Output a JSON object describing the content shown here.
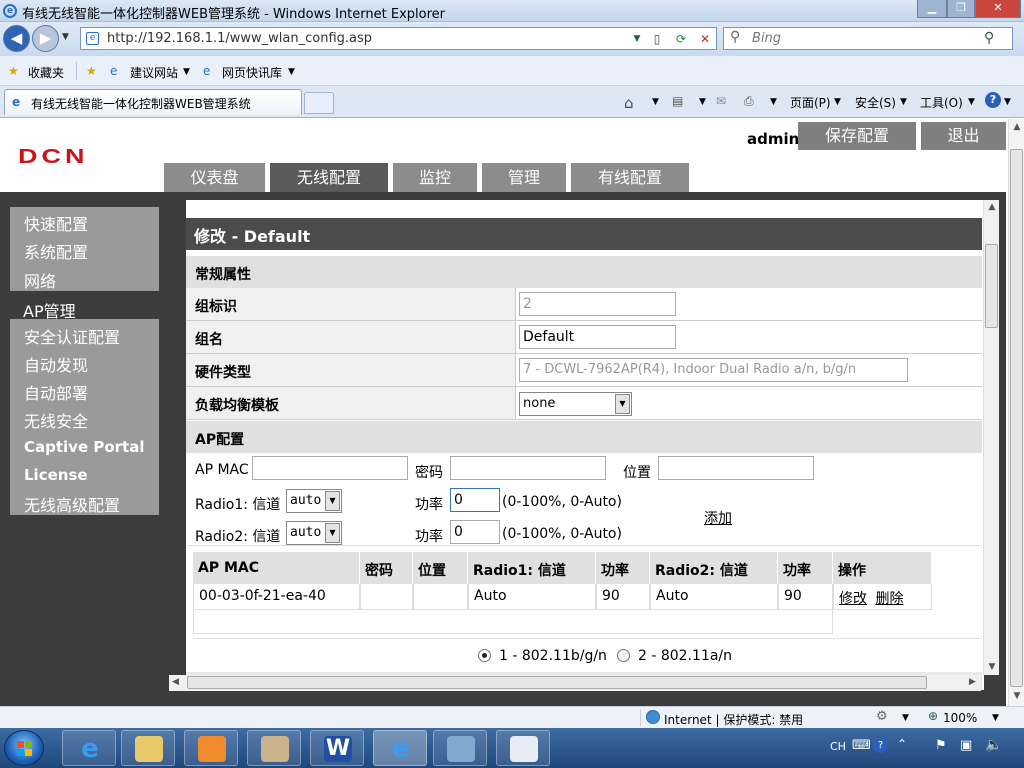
{
  "browser": {
    "title": "有线无线智能一体化控制器WEB管理系统 - Windows Internet Explorer",
    "url": "http://192.168.1.1/www_wlan_config.asp",
    "search_placeholder": "Bing",
    "favorites_label": "收藏夹",
    "fav_link1": "建议网站",
    "fav_link2": "网页快讯库",
    "tab_title": "有线无线智能一体化控制器WEB管理系统",
    "cmd_page": "页面(P)",
    "cmd_safety": "安全(S)",
    "cmd_tools": "工具(O)"
  },
  "header": {
    "logo": "DCN",
    "user": "admin",
    "save_btn": "保存配置",
    "logout_btn": "退出"
  },
  "main_tabs": [
    "仪表盘",
    "无线配置",
    "监控",
    "管理",
    "有线配置"
  ],
  "active_tab": "无线配置",
  "sidebar": {
    "items": [
      "快速配置",
      "系统配置",
      "网络",
      "AP管理",
      "安全认证配置",
      "自动发现",
      "自动部署",
      "无线安全",
      "Captive Portal",
      "License",
      "无线高级配置"
    ],
    "active": "AP管理"
  },
  "form": {
    "title": "修改 - Default",
    "general_section": "常规属性",
    "group_id_label": "组标识",
    "group_id_value": "2",
    "group_name_label": "组名",
    "group_name_value": "Default",
    "hw_type_label": "硬件类型",
    "hw_type_value": "7 - DCWL-7962AP(R4), Indoor Dual Radio a/n, b/g/n",
    "lb_label": "负载均衡模板",
    "lb_value": "none",
    "ap_section": "AP配置",
    "ap_mac_label": "AP MAC",
    "password_label": "密码",
    "location_label": "位置",
    "radio1_label": "Radio1: 信道",
    "radio1_channel": "auto",
    "radio2_label": "Radio2: 信道",
    "radio2_channel": "auto",
    "power_label": "功率",
    "power1_value": "0",
    "power2_value": "0",
    "power_hint": "(0-100%, 0-Auto)",
    "add_link": "添加"
  },
  "ap_table": {
    "headers": [
      "AP MAC",
      "密码",
      "位置",
      "Radio1: 信道",
      "功率",
      "Radio2: 信道",
      "功率",
      "操作"
    ],
    "row": [
      "00-03-0f-21-ea-40",
      "",
      "",
      "Auto",
      "90",
      "Auto",
      "90"
    ],
    "edit": "修改",
    "delete": "删除"
  },
  "radio_modes": {
    "option1": "1 - 802.11b/g/n",
    "option2": "2 - 802.11a/n",
    "selected": 1
  },
  "statusbar": {
    "zone": "Internet | 保护模式: 禁用",
    "zoom": "100%"
  },
  "taskbar": {
    "lang": "CH"
  },
  "colors": {
    "logo_red": "#c8141a",
    "dark_bg": "#3c3c3c",
    "tab_active": "#5a5a5a",
    "tab_inactive": "#8c8c8c",
    "section_gray": "#e0e0e0"
  }
}
